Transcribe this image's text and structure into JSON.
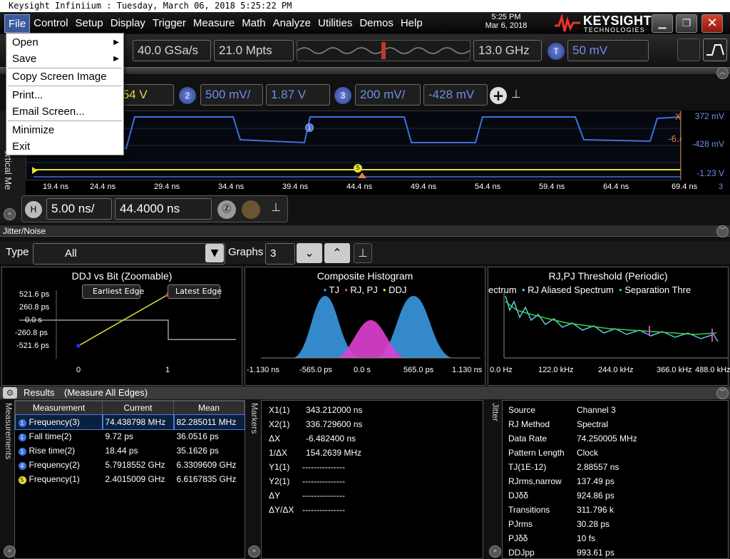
{
  "window": {
    "title": "Keysight Infiniium : Tuesday, March 06, 2018 5:25:22 PM"
  },
  "menu": [
    "File",
    "Control",
    "Setup",
    "Display",
    "Trigger",
    "Measure",
    "Math",
    "Analyze",
    "Utilities",
    "Demos",
    "Help"
  ],
  "clock": {
    "time": "5:25 PM",
    "date": "Mar 6, 2018"
  },
  "logo": {
    "name": "KEYSIGHT",
    "sub": "TECHNOLOGIES"
  },
  "file_menu": {
    "open": "Open",
    "save": "Save",
    "copy": "Copy Screen Image",
    "print": "Print...",
    "email": "Email Screen...",
    "minimize": "Minimize",
    "exit": "Exit"
  },
  "toolbar": {
    "sample_rate": "40.0 GSa/s",
    "memory_depth": "21.0 Mpts",
    "bandwidth": "13.0 GHz",
    "trigger_badge": "T",
    "trigger_level": "50 mV"
  },
  "channels": {
    "ch1_offset_partial": ".54 V",
    "ch2_badge": "2",
    "ch2_scale": "500 mV/",
    "ch2_offset": "1.87 V",
    "ch3_badge": "3",
    "ch3_scale": "200 mV/",
    "ch3_offset": "-428 mV"
  },
  "waveform": {
    "x_ticks": [
      "19.4 ns",
      "24.4 ns",
      "29.4 ns",
      "34.4 ns",
      "39.4 ns",
      "44.4 ns",
      "49.4 ns",
      "54.4 ns",
      "59.4 ns",
      "64.4 ns",
      "69.4 ns"
    ],
    "right_labels": {
      "top": "372 mV",
      "mid": "-428 mV",
      "bottom": "-1.23 V",
      "count": "3"
    },
    "marker_partial": "-6.4",
    "marker_x": "X",
    "marker1": "1",
    "marker5": "5",
    "side_label": "ertical Me"
  },
  "horizontal": {
    "h_badge": "H",
    "scale": "5.00 ns/",
    "position": "44.4000 ns"
  },
  "jitter": {
    "title": "Jitter/Noise",
    "type_label": "Type",
    "type_value": "All",
    "graphs_label": "Graphs",
    "graphs_value": "3"
  },
  "chart_data": [
    {
      "type": "line",
      "title": "DDJ vs Bit (Zoomable)",
      "annotations": [
        "Earliest Edge",
        "Latest Edge"
      ],
      "y_ticks": [
        "521.6 ps",
        "260.8 ps",
        "0.0 s",
        "-260.8 ps",
        "-521.6 ps"
      ],
      "x_ticks": [
        "0",
        "1"
      ],
      "ylim": [
        -521.6,
        521.6
      ],
      "xlim": [
        -0.6,
        1.9
      ],
      "series": [
        {
          "x": [
            0,
            1
          ],
          "y": [
            -521.6,
            521.6
          ]
        }
      ]
    },
    {
      "type": "area",
      "title": "Composite Histogram",
      "legend": [
        "TJ",
        "RJ, PJ",
        "DDJ"
      ],
      "x_ticks": [
        "-1.130 ns",
        "-565.0 ps",
        "0.0 s",
        "565.0 ps",
        "1.130 ns"
      ]
    },
    {
      "type": "line",
      "title": "RJ,PJ Threshold (Periodic)",
      "legend_text": "ectrum",
      "legend": [
        "RJ Aliased Spectrum",
        "Separation Thre"
      ],
      "x_ticks": [
        "0.0 Hz",
        "122.0 kHz",
        "244.0 kHz",
        "366.0 kHz",
        "488.0 kHz"
      ]
    }
  ],
  "results": {
    "title": "Results",
    "subtitle": "(Measure All Edges)",
    "columns": [
      "Measurement",
      "Current",
      "Mean"
    ],
    "rows": [
      {
        "badge": "1",
        "name": "Frequency(3)",
        "current": "74.438798 MHz",
        "mean": "82.285011 MHz"
      },
      {
        "badge": "1",
        "name": "Fall time(2)",
        "current": "9.72 ps",
        "mean": "36.0516 ps"
      },
      {
        "badge": "1",
        "name": "Rise time(2)",
        "current": "18.44 ps",
        "mean": "35.1626 ps"
      },
      {
        "badge": "4",
        "name": "Frequency(2)",
        "current": "5.7918552 GHz",
        "mean": "6.3309609 GHz"
      },
      {
        "badge": "5",
        "name": "Frequency(1)",
        "current": "2.4015009 GHz",
        "mean": "6.6167835 GHz"
      }
    ]
  },
  "panel_titles": {
    "measurements": "Measurements",
    "markers": "Markers",
    "jitter": "Jitter"
  },
  "markers": [
    {
      "k": "X1(1)",
      "v": "343.212000 ns"
    },
    {
      "k": "X2(1)",
      "v": "336.729600 ns"
    },
    {
      "k": "ΔX",
      "v": "-6.482400 ns"
    },
    {
      "k": "1/ΔX",
      "v": "154.2639 MHz"
    },
    {
      "k": "Y1(1)",
      "v": "---------------"
    },
    {
      "k": "Y2(1)",
      "v": "---------------"
    },
    {
      "k": "ΔY",
      "v": "---------------"
    },
    {
      "k": "ΔY/ΔX",
      "v": "---------------"
    }
  ],
  "jitter_info": [
    {
      "k": "Source",
      "v": "Channel 3"
    },
    {
      "k": "RJ Method",
      "v": "Spectral"
    },
    {
      "k": "Data Rate",
      "v": "74.250005 MHz"
    },
    {
      "k": "Pattern Length",
      "v": "Clock"
    },
    {
      "k": "TJ(1E-12)",
      "v": "2.88557 ns"
    },
    {
      "k": "RJrms,narrow",
      "v": "137.49 ps"
    },
    {
      "k": "DJδδ",
      "v": "924.86 ps"
    },
    {
      "k": "Transitions",
      "v": "311.796 k"
    },
    {
      "k": "PJrms",
      "v": "30.28 ps"
    },
    {
      "k": "PJδδ",
      "v": "10 fs"
    },
    {
      "k": "DDJpp",
      "v": "993.61 ps"
    }
  ],
  "colors": {
    "ch1": "#e6df33",
    "ch2": "#3f6fe0",
    "tj": "#3a98e0",
    "rjpj": "#e040d0",
    "ddj": "#e6df33",
    "accent": "#3b5a9c"
  }
}
